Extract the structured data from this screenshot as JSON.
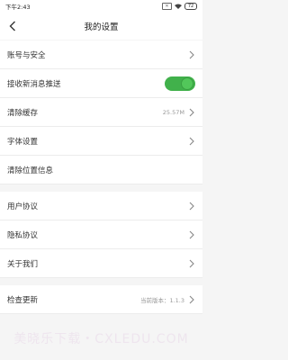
{
  "status_bar": {
    "time": "下午2:43",
    "battery": "72"
  },
  "nav": {
    "title": "我的设置"
  },
  "items": [
    {
      "label": "账号与安全"
    },
    {
      "label": "接收新消息推送"
    },
    {
      "label": "清除缓存",
      "value": "25.57M"
    },
    {
      "label": "字体设置"
    },
    {
      "label": "清除位置信息"
    },
    {
      "label": "用户协议"
    },
    {
      "label": "隐私协议"
    },
    {
      "label": "关于我们"
    },
    {
      "label": "检查更新",
      "value": "当前版本：1.1.3"
    }
  ],
  "push_enabled": true,
  "watermark": "美晓乐下载・CXLEDU.COM",
  "colors": {
    "toggle_on": "#41b14b",
    "background": "#f5f5f5"
  }
}
